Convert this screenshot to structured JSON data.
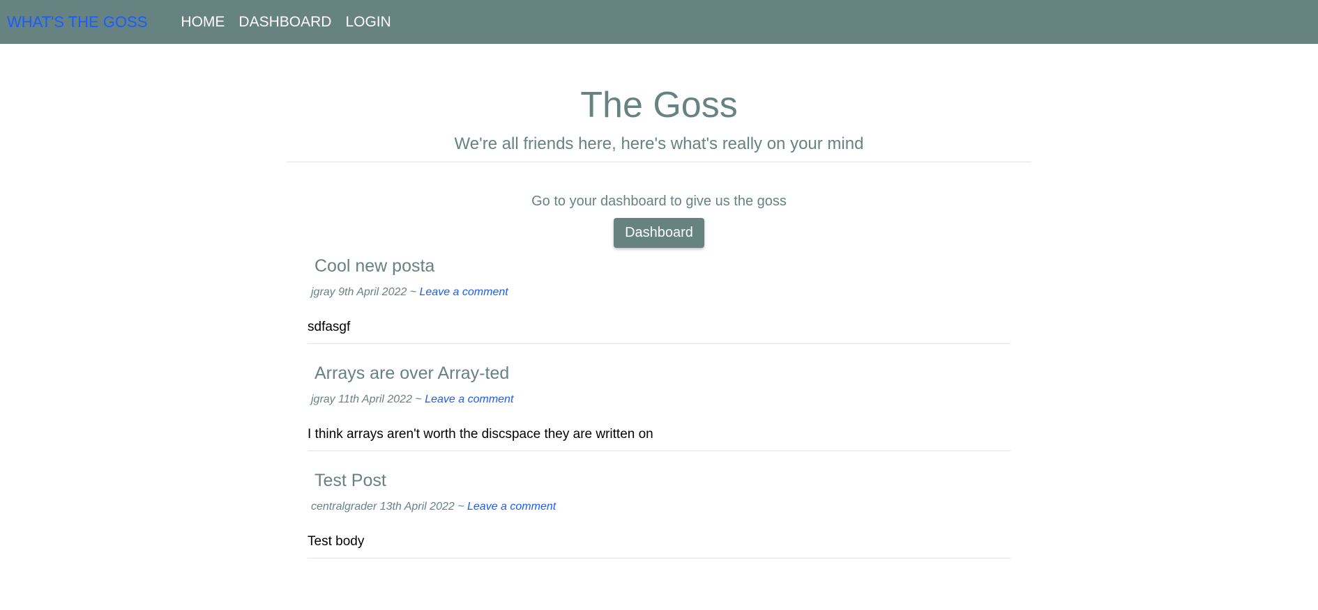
{
  "navbar": {
    "brand": "WHAT'S THE GOSS",
    "links": [
      "HOME",
      "DASHBOARD",
      "LOGIN"
    ]
  },
  "hero": {
    "title": "The Goss",
    "subtitle": "We're all friends here, here's what's really on your mind"
  },
  "cta": {
    "text": "Go to your dashboard to give us the goss",
    "button_label": "Dashboard"
  },
  "posts": [
    {
      "title": "Cool new posta",
      "meta": "jgray 9th April 2022 ~ ",
      "comment_link": "Leave a comment",
      "body": "sdfasgf"
    },
    {
      "title": "Arrays are over Array-ted",
      "meta": "jgray 11th April 2022 ~ ",
      "comment_link": "Leave a comment",
      "body": "I think arrays aren't worth the discspace they are written on"
    },
    {
      "title": "Test Post",
      "meta": "centralgrader 13th April 2022 ~ ",
      "comment_link": "Leave a comment",
      "body": "Test body"
    }
  ],
  "colors": {
    "navbar_bg": "#668281",
    "brand": "#1a5cff",
    "accent": "#668281",
    "link": "#1a5cff"
  }
}
